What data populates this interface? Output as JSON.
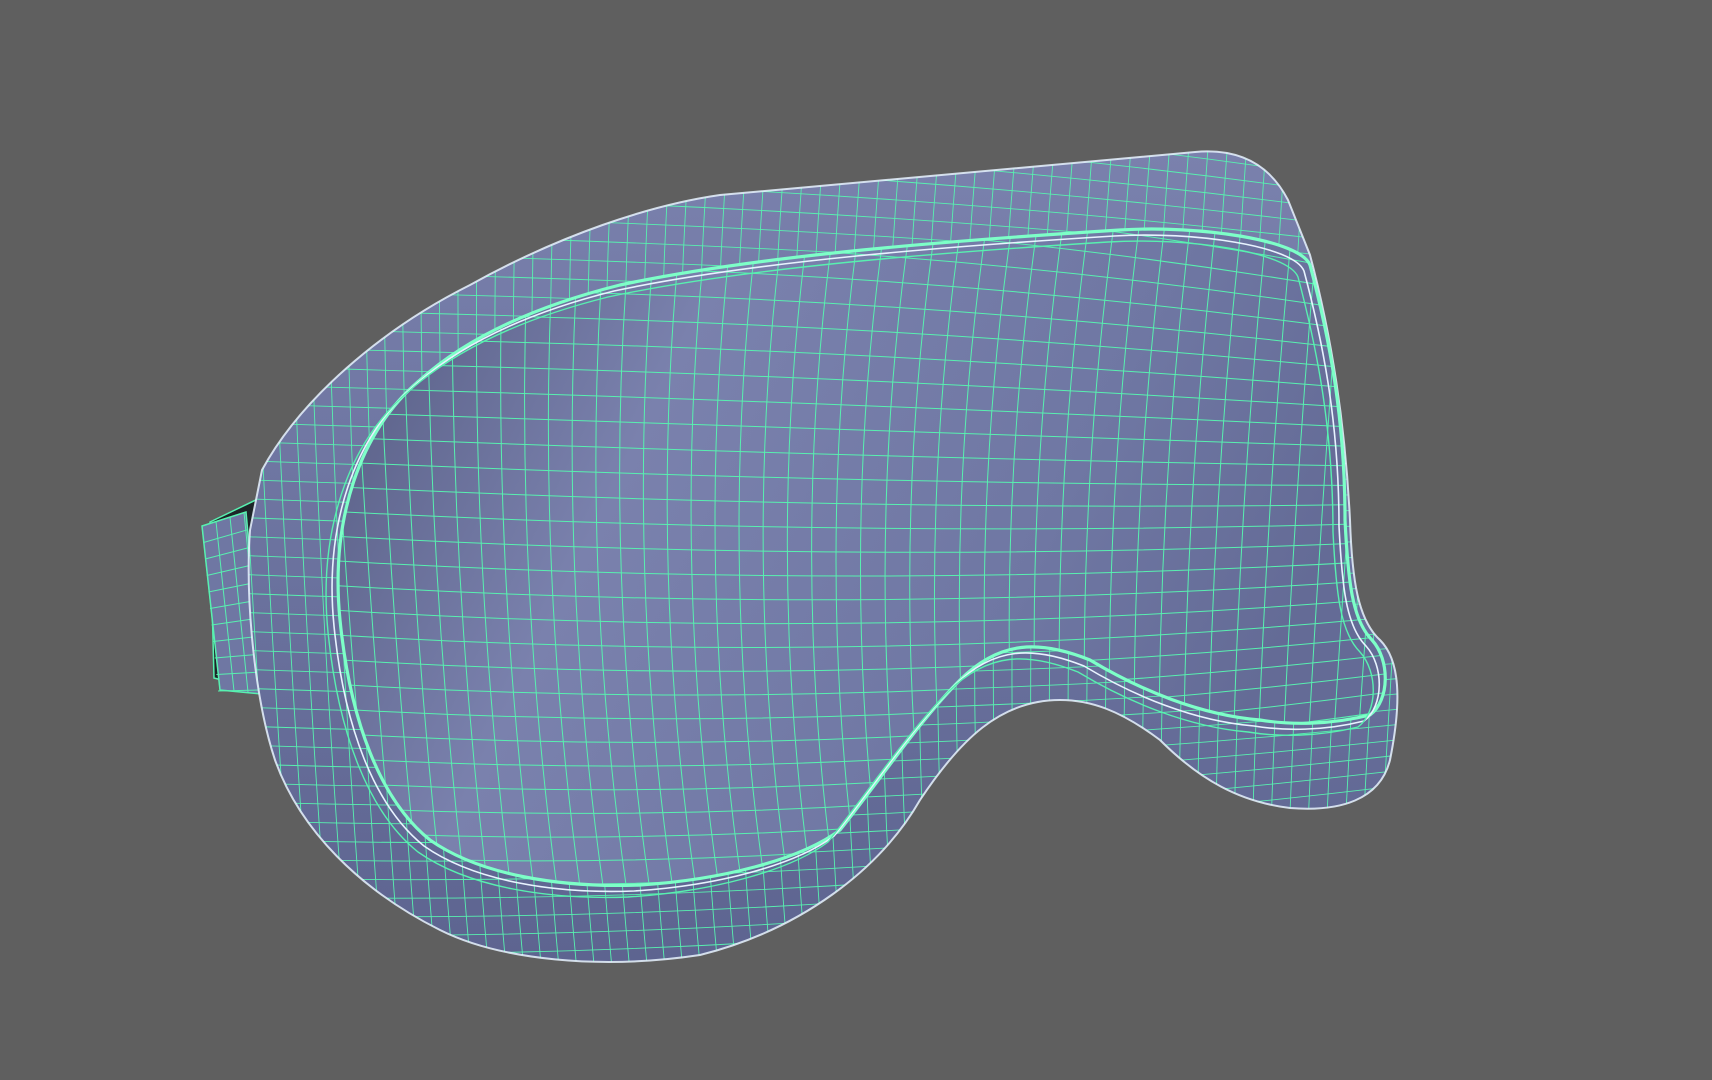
{
  "viewport": {
    "background_color": "#5f5f5f",
    "shading_mode": "wireframe-on-shaded"
  },
  "model": {
    "object": "goggles",
    "parts": [
      "strap",
      "frame",
      "lens",
      "nose-cutout"
    ],
    "colors": {
      "surface": "#6f77a3",
      "surface_dark": "#545a80",
      "surface_light": "#8289b4",
      "wire": "#58f0b0",
      "wire_bright": "#7dffc8",
      "edge_highlight": "#e8f3ff",
      "strap_inner": "#1d2528"
    }
  }
}
